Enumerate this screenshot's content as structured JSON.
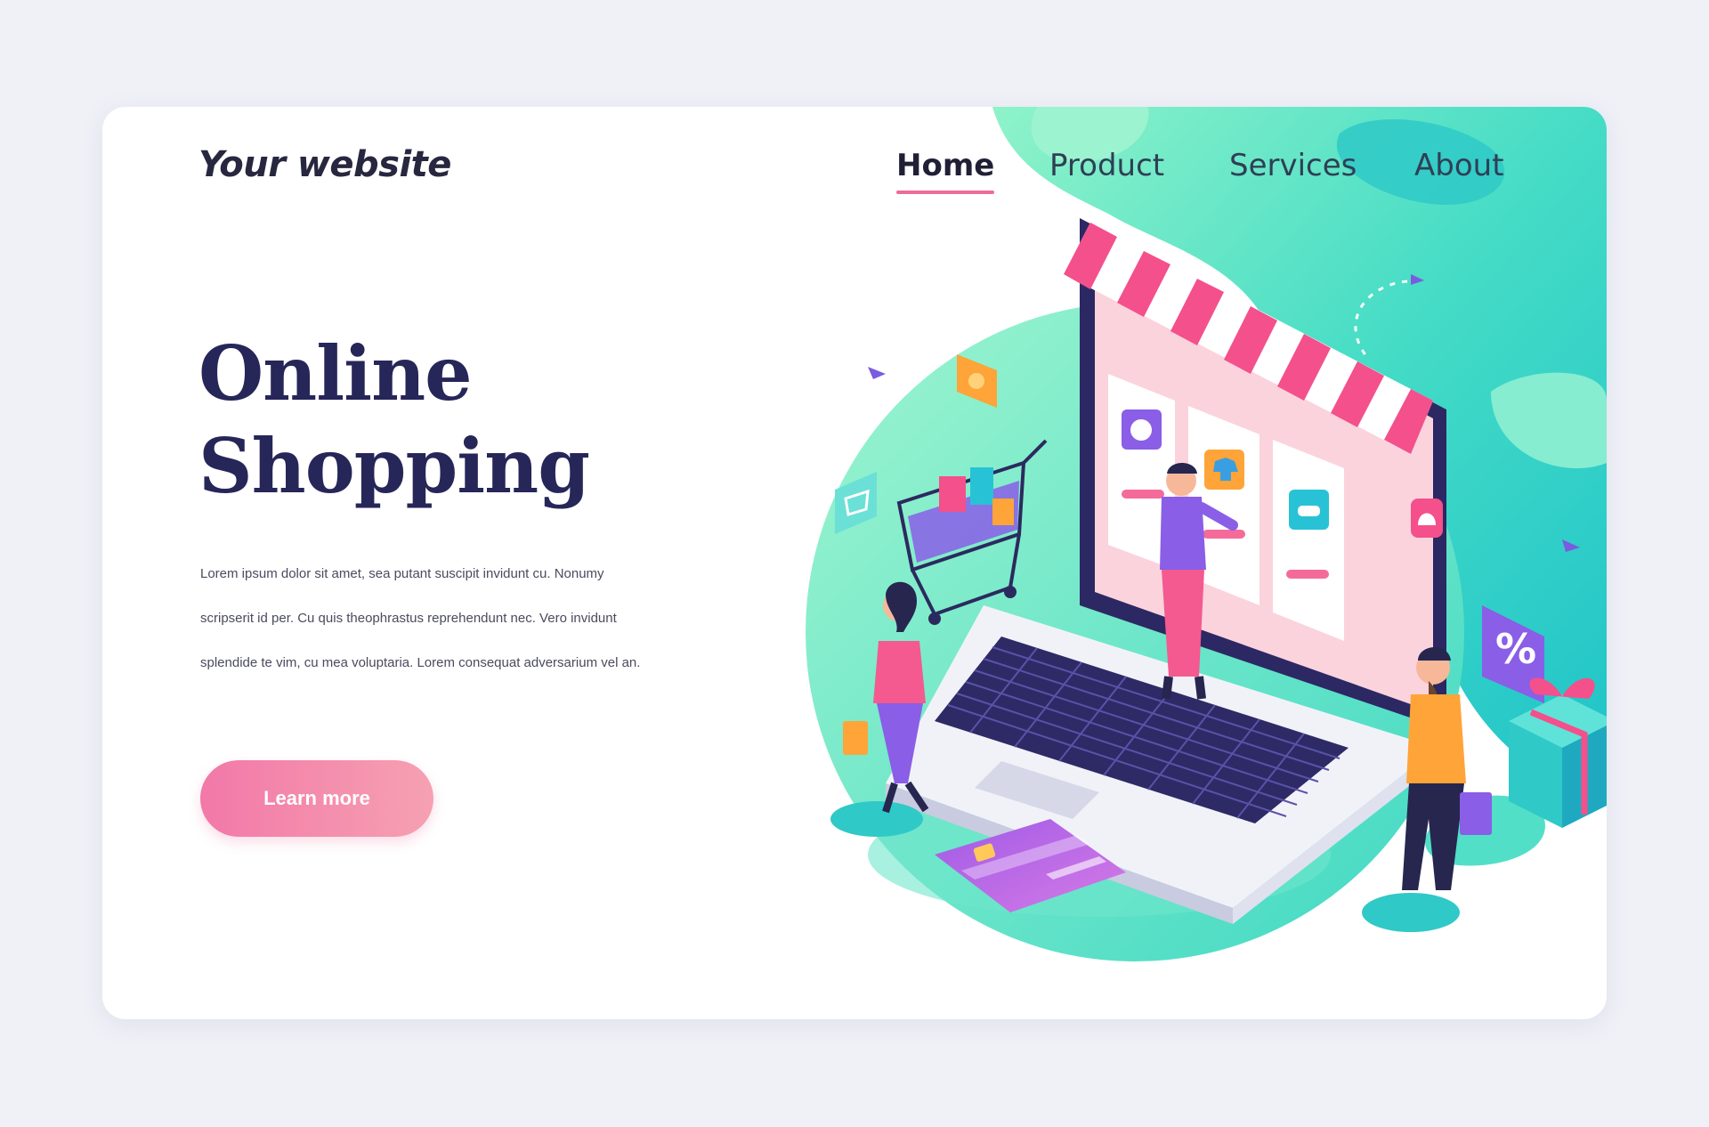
{
  "site": {
    "logo_text": "Your website"
  },
  "nav": {
    "items": [
      {
        "label": "Home",
        "active": true
      },
      {
        "label": "Product",
        "active": false
      },
      {
        "label": "Services",
        "active": false
      },
      {
        "label": "About",
        "active": false
      }
    ]
  },
  "hero": {
    "title_line1": "Online",
    "title_line2": "Shopping",
    "description": "Lorem ipsum dolor sit amet, sea putant suscipit invidunt cu. Nonumy scripserit id per. Cu quis theophrastus reprehendunt nec. Vero invidunt splendide te vim, cu mea voluptaria. Lorem consequat adversarium vel an.",
    "cta_label": "Learn more"
  },
  "illustration": {
    "discount_badge_text": "%",
    "icons": [
      "laptop-icon",
      "shop-awning-icon",
      "shopping-cart-icon",
      "gift-box-icon",
      "credit-card-icon",
      "gear-icon",
      "tshirt-icon",
      "gamepad-icon",
      "bell-icon",
      "paper-plane-icon",
      "percent-badge-icon"
    ]
  },
  "colors": {
    "accent_pink": "#ef6b98",
    "title_navy": "#262659",
    "teal": "#34d4c2",
    "mint": "#84f0c6",
    "purple": "#8e4fe0"
  }
}
